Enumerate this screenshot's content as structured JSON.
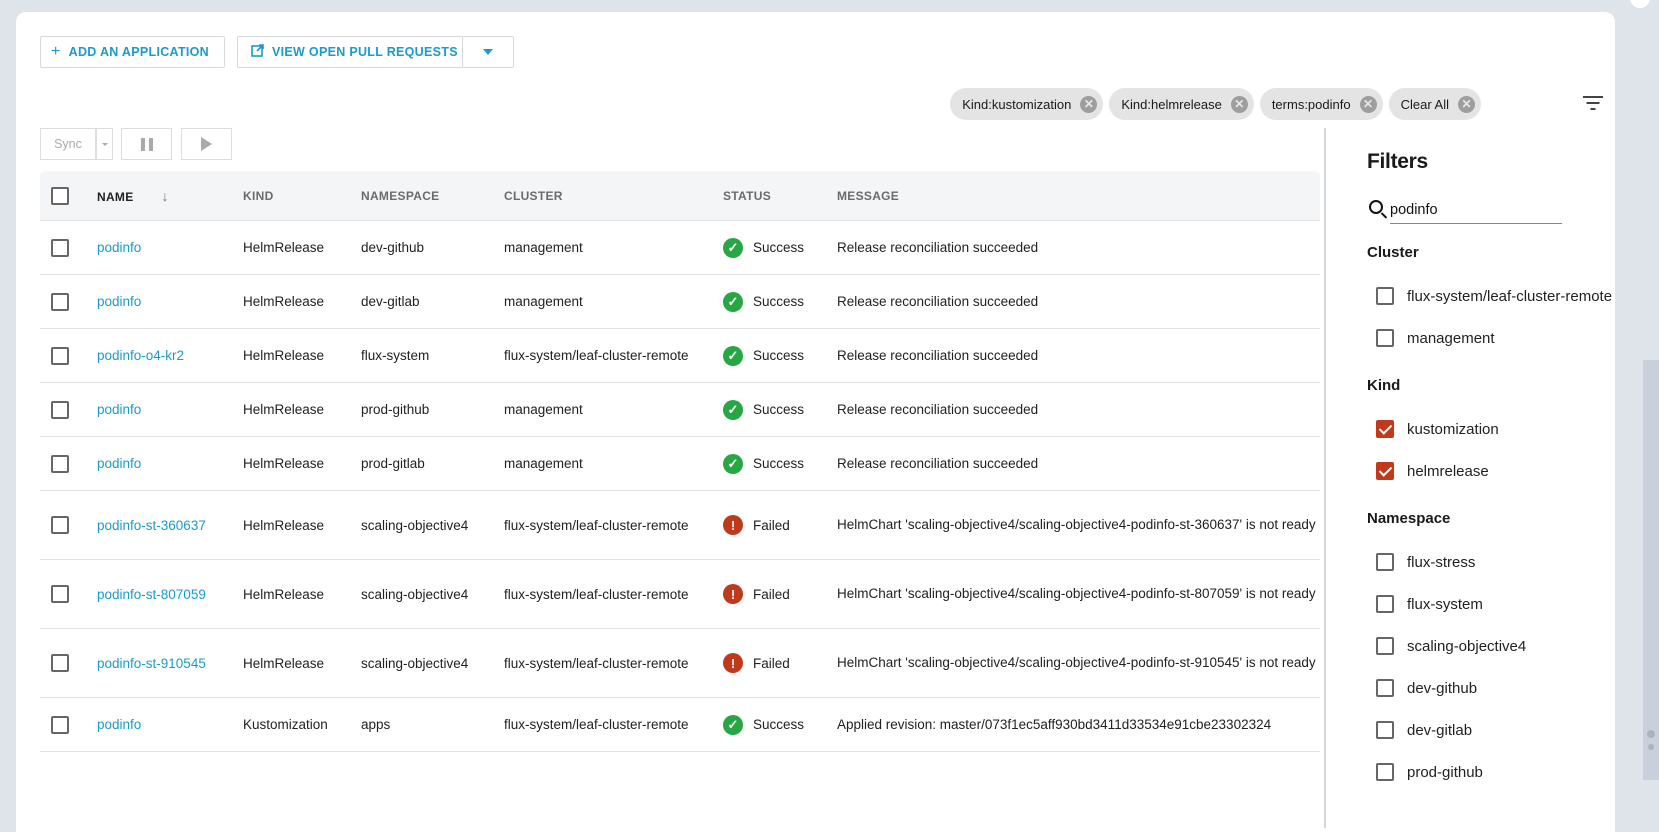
{
  "toolbar": {
    "add_application_label": "ADD AN APPLICATION",
    "view_prs_label": "VIEW OPEN PULL REQUESTS",
    "sync_label": "Sync"
  },
  "active_filters": [
    {
      "label": "Kind:kustomization"
    },
    {
      "label": "Kind:helmrelease"
    },
    {
      "label": "terms:podinfo"
    },
    {
      "label": "Clear All"
    }
  ],
  "table": {
    "columns": [
      "NAME",
      "KIND",
      "NAMESPACE",
      "CLUSTER",
      "STATUS",
      "MESSAGE"
    ],
    "rows": [
      {
        "name": "podinfo",
        "kind": "HelmRelease",
        "namespace": "dev-github",
        "cluster": "management",
        "status": "Success",
        "message": "Release reconciliation succeeded"
      },
      {
        "name": "podinfo",
        "kind": "HelmRelease",
        "namespace": "dev-gitlab",
        "cluster": "management",
        "status": "Success",
        "message": "Release reconciliation succeeded"
      },
      {
        "name": "podinfo-o4-kr2",
        "kind": "HelmRelease",
        "namespace": "flux-system",
        "cluster": "flux-system/leaf-cluster-remote",
        "status": "Success",
        "message": "Release reconciliation succeeded"
      },
      {
        "name": "podinfo",
        "kind": "HelmRelease",
        "namespace": "prod-github",
        "cluster": "management",
        "status": "Success",
        "message": "Release reconciliation succeeded"
      },
      {
        "name": "podinfo",
        "kind": "HelmRelease",
        "namespace": "prod-gitlab",
        "cluster": "management",
        "status": "Success",
        "message": "Release reconciliation succeeded"
      },
      {
        "name": "podinfo-st-360637",
        "kind": "HelmRelease",
        "namespace": "scaling-objective4",
        "cluster": "flux-system/leaf-cluster-remote",
        "status": "Failed",
        "message": "HelmChart 'scaling-objective4/scaling-objective4-podinfo-st-360637' is not ready"
      },
      {
        "name": "podinfo-st-807059",
        "kind": "HelmRelease",
        "namespace": "scaling-objective4",
        "cluster": "flux-system/leaf-cluster-remote",
        "status": "Failed",
        "message": "HelmChart 'scaling-objective4/scaling-objective4-podinfo-st-807059' is not ready"
      },
      {
        "name": "podinfo-st-910545",
        "kind": "HelmRelease",
        "namespace": "scaling-objective4",
        "cluster": "flux-system/leaf-cluster-remote",
        "status": "Failed",
        "message": "HelmChart 'scaling-objective4/scaling-objective4-podinfo-st-910545' is not ready"
      },
      {
        "name": "podinfo",
        "kind": "Kustomization",
        "namespace": "apps",
        "cluster": "flux-system/leaf-cluster-remote",
        "status": "Success",
        "message": "Applied revision: master/073f1ec5aff930bd3411d33534e91cbe23302324"
      }
    ]
  },
  "filters": {
    "title": "Filters",
    "search_value": "podinfo",
    "sections": [
      {
        "title": "Cluster",
        "options": [
          {
            "label": "flux-system/leaf-cluster-remote",
            "checked": false
          },
          {
            "label": "management",
            "checked": false
          }
        ]
      },
      {
        "title": "Kind",
        "options": [
          {
            "label": "kustomization",
            "checked": true
          },
          {
            "label": "helmrelease",
            "checked": true
          }
        ]
      },
      {
        "title": "Namespace",
        "options": [
          {
            "label": "flux-stress",
            "checked": false
          },
          {
            "label": "flux-system",
            "checked": false
          },
          {
            "label": "scaling-objective4",
            "checked": false
          },
          {
            "label": "dev-github",
            "checked": false
          },
          {
            "label": "dev-gitlab",
            "checked": false
          },
          {
            "label": "prod-github",
            "checked": false
          }
        ]
      }
    ]
  },
  "colors": {
    "accent": "#1a9bd0",
    "success": "#27a744",
    "failed": "#c0391d",
    "checked": "#c0391d"
  }
}
